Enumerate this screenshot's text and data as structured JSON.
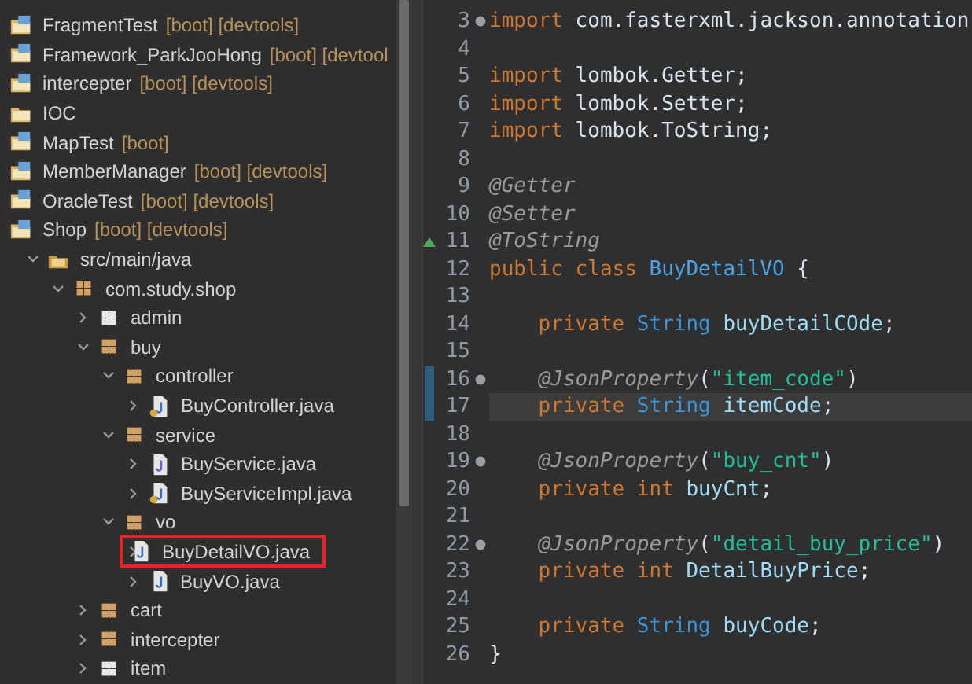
{
  "tree": [
    {
      "label": "FragmentTest",
      "kind": "project",
      "decoration": "[boot] [devtools]"
    },
    {
      "label": "Framework_ParkJooHong",
      "kind": "project",
      "decoration": "[boot] [devtool"
    },
    {
      "label": "intercepter",
      "kind": "project",
      "decoration": "[boot] [devtools]"
    },
    {
      "label": "IOC",
      "kind": "plain-project"
    },
    {
      "label": "MapTest",
      "kind": "project",
      "decoration": "[boot]"
    },
    {
      "label": "MemberManager",
      "kind": "project",
      "decoration": "[boot] [devtools]"
    },
    {
      "label": "OracleTest",
      "kind": "project",
      "decoration": "[boot] [devtools]"
    },
    {
      "label": "Shop",
      "kind": "project",
      "decoration": "[boot] [devtools]",
      "children": [
        {
          "label": "src/main/java",
          "kind": "source-folder",
          "expanded": true,
          "children": [
            {
              "label": "com.study.shop",
              "kind": "package",
              "expanded": true,
              "children": [
                {
                  "label": "admin",
                  "kind": "empty-package",
                  "expanded": false
                },
                {
                  "label": "buy",
                  "kind": "package",
                  "expanded": true,
                  "children": [
                    {
                      "label": "controller",
                      "kind": "package",
                      "expanded": true,
                      "children": [
                        {
                          "label": "BuyController.java",
                          "kind": "class-file",
                          "expanded": false
                        }
                      ]
                    },
                    {
                      "label": "service",
                      "kind": "package",
                      "expanded": true,
                      "children": [
                        {
                          "label": "BuyService.java",
                          "kind": "interface-file",
                          "expanded": false
                        },
                        {
                          "label": "BuyServiceImpl.java",
                          "kind": "class-file",
                          "expanded": false
                        }
                      ]
                    },
                    {
                      "label": "vo",
                      "kind": "package",
                      "expanded": true,
                      "children": [
                        {
                          "label": "BuyDetailVO.java",
                          "kind": "file",
                          "expanded": false,
                          "boxed": true
                        },
                        {
                          "label": "BuyVO.java",
                          "kind": "file",
                          "expanded": false,
                          "boxed": false
                        }
                      ]
                    }
                  ]
                },
                {
                  "label": "cart",
                  "kind": "package",
                  "expanded": false
                },
                {
                  "label": "intercepter",
                  "kind": "package",
                  "expanded": false
                },
                {
                  "label": "item",
                  "kind": "empty-package",
                  "expanded": false
                }
              ]
            }
          ]
        }
      ]
    }
  ],
  "code": [
    {
      "number": "3",
      "fold": true,
      "current": false,
      "override": false,
      "changed": false,
      "tokens": [
        {
          "kind": "keyword",
          "text": "import"
        },
        {
          "kind": "plain",
          "text": " com.fasterxml.jackson.annotation"
        }
      ]
    },
    {
      "number": "4",
      "fold": false,
      "current": false,
      "override": false,
      "changed": false
    },
    {
      "number": "5",
      "fold": false,
      "current": false,
      "override": false,
      "changed": false,
      "tokens": [
        {
          "kind": "keyword",
          "text": "import"
        },
        {
          "kind": "plain",
          "text": " lombok.Getter;"
        }
      ]
    },
    {
      "number": "6",
      "fold": false,
      "current": false,
      "override": false,
      "changed": false,
      "tokens": [
        {
          "kind": "keyword",
          "text": "import"
        },
        {
          "kind": "plain",
          "text": " lombok.Setter;"
        }
      ]
    },
    {
      "number": "7",
      "fold": false,
      "current": false,
      "override": false,
      "changed": false,
      "tokens": [
        {
          "kind": "keyword",
          "text": "import"
        },
        {
          "kind": "plain",
          "text": " lombok.ToString;"
        }
      ]
    },
    {
      "number": "8",
      "fold": false,
      "current": false,
      "override": false,
      "changed": false
    },
    {
      "number": "9",
      "fold": false,
      "current": false,
      "override": false,
      "changed": false,
      "tokens": [
        {
          "kind": "annotation",
          "text": "@Getter"
        }
      ]
    },
    {
      "number": "10",
      "fold": false,
      "current": false,
      "override": false,
      "changed": false,
      "tokens": [
        {
          "kind": "annotation",
          "text": "@Setter"
        }
      ]
    },
    {
      "number": "11",
      "fold": false,
      "current": false,
      "override": true,
      "changed": false,
      "tokens": [
        {
          "kind": "annotation",
          "text": "@ToString"
        }
      ]
    },
    {
      "number": "12",
      "fold": false,
      "current": false,
      "override": false,
      "changed": false,
      "tokens": [
        {
          "kind": "keyword",
          "text": "public class"
        },
        {
          "kind": "classname",
          "text": " BuyDetailVO"
        },
        {
          "kind": "plain",
          "text": " {"
        }
      ]
    },
    {
      "number": "13",
      "fold": false,
      "current": false,
      "override": false,
      "changed": false
    },
    {
      "number": "14",
      "fold": false,
      "current": false,
      "override": false,
      "changed": false,
      "tokens": [
        {
          "kind": "keyword",
          "text": "    private"
        },
        {
          "kind": "type",
          "text": " String"
        },
        {
          "kind": "field",
          "text": " buyDetailCOde"
        },
        {
          "kind": "plain",
          "text": ";"
        }
      ]
    },
    {
      "number": "15",
      "fold": false,
      "current": false,
      "override": false,
      "changed": false
    },
    {
      "number": "16",
      "fold": true,
      "current": false,
      "override": false,
      "changed": true,
      "tokens": [
        {
          "kind": "annotation",
          "text": "    @JsonProperty"
        },
        {
          "kind": "plain",
          "text": "("
        },
        {
          "kind": "string",
          "text": "\"item_code\""
        },
        {
          "kind": "plain",
          "text": ")"
        }
      ]
    },
    {
      "number": "17",
      "fold": false,
      "current": true,
      "override": false,
      "changed": true,
      "tokens": [
        {
          "kind": "keyword",
          "text": "    private"
        },
        {
          "kind": "type",
          "text": " String"
        },
        {
          "kind": "field",
          "text": " itemCode"
        },
        {
          "kind": "plain",
          "text": ";"
        }
      ]
    },
    {
      "number": "18",
      "fold": false,
      "current": false,
      "override": false,
      "changed": false
    },
    {
      "number": "19",
      "fold": true,
      "current": false,
      "override": false,
      "changed": false,
      "tokens": [
        {
          "kind": "annotation",
          "text": "    @JsonProperty"
        },
        {
          "kind": "plain",
          "text": "("
        },
        {
          "kind": "string",
          "text": "\"buy_cnt\""
        },
        {
          "kind": "plain",
          "text": ")"
        }
      ]
    },
    {
      "number": "20",
      "fold": false,
      "current": false,
      "override": false,
      "changed": false,
      "tokens": [
        {
          "kind": "keyword",
          "text": "    private int"
        },
        {
          "kind": "field",
          "text": " buyCnt"
        },
        {
          "kind": "plain",
          "text": ";"
        }
      ]
    },
    {
      "number": "21",
      "fold": false,
      "current": false,
      "override": false,
      "changed": false
    },
    {
      "number": "22",
      "fold": true,
      "current": false,
      "override": false,
      "changed": false,
      "tokens": [
        {
          "kind": "annotation",
          "text": "    @JsonProperty"
        },
        {
          "kind": "plain",
          "text": "("
        },
        {
          "kind": "string",
          "text": "\"detail_buy_price\""
        },
        {
          "kind": "plain",
          "text": ")"
        }
      ]
    },
    {
      "number": "23",
      "fold": false,
      "current": false,
      "override": false,
      "changed": false,
      "tokens": [
        {
          "kind": "keyword",
          "text": "    private int"
        },
        {
          "kind": "field",
          "text": " DetailBuyPrice"
        },
        {
          "kind": "plain",
          "text": ";"
        }
      ]
    },
    {
      "number": "24",
      "fold": false,
      "current": false,
      "override": false,
      "changed": false
    },
    {
      "number": "25",
      "fold": false,
      "current": false,
      "override": false,
      "changed": false,
      "tokens": [
        {
          "kind": "keyword",
          "text": "    private"
        },
        {
          "kind": "type",
          "text": " String"
        },
        {
          "kind": "field",
          "text": " buyCode"
        },
        {
          "kind": "plain",
          "text": ";"
        }
      ]
    },
    {
      "number": "26",
      "fold": false,
      "current": false,
      "override": false,
      "changed": false,
      "tokens": [
        {
          "kind": "plain",
          "text": "}"
        }
      ]
    }
  ]
}
